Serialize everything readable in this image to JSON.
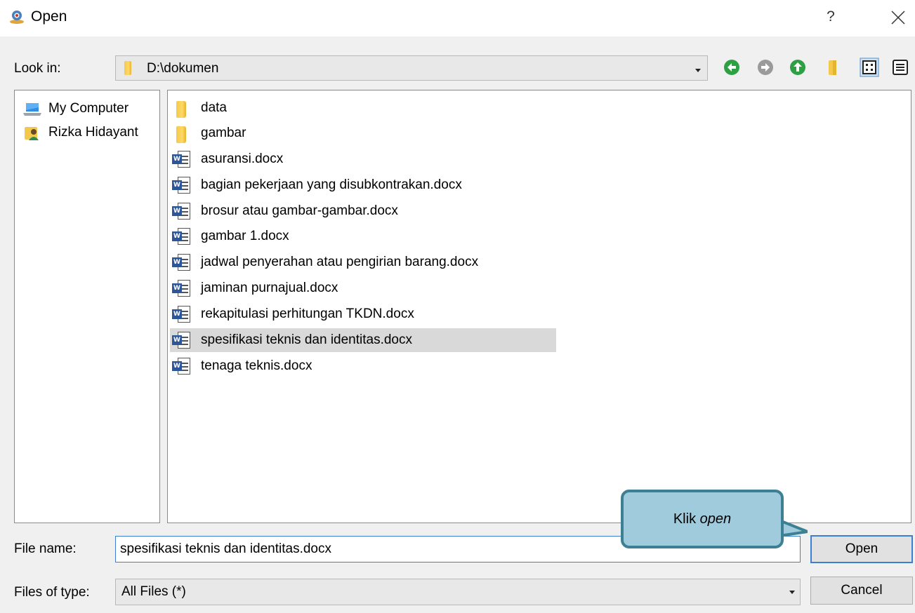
{
  "window": {
    "title": "Open",
    "help_label": "?",
    "close_icon": "close-icon",
    "app_icon": "java-app-icon"
  },
  "look_in": {
    "label": "Look in:",
    "value": "D:\\dokumen",
    "toolbar": [
      "back-icon",
      "forward-icon",
      "up-folder-icon",
      "new-folder-icon",
      "list-view-icon",
      "details-view-icon"
    ]
  },
  "sidebar": {
    "items": [
      {
        "label": "My Computer",
        "icon": "computer-icon"
      },
      {
        "label": "Rizka Hidayant",
        "icon": "user-folder-icon"
      }
    ]
  },
  "files": [
    {
      "name": "data",
      "type": "folder"
    },
    {
      "name": "gambar",
      "type": "folder"
    },
    {
      "name": "asuransi.docx",
      "type": "docx"
    },
    {
      "name": "bagian pekerjaan yang disubkontrakan.docx",
      "type": "docx"
    },
    {
      "name": "brosur atau gambar-gambar.docx",
      "type": "docx"
    },
    {
      "name": "gambar 1.docx",
      "type": "docx"
    },
    {
      "name": "jadwal penyerahan atau pengirian barang.docx",
      "type": "docx"
    },
    {
      "name": "jaminan purnajual.docx",
      "type": "docx"
    },
    {
      "name": "rekapitulasi perhitungan TKDN.docx",
      "type": "docx"
    },
    {
      "name": "spesifikasi teknis dan identitas.docx",
      "type": "docx",
      "selected": true
    },
    {
      "name": "tenaga teknis.docx",
      "type": "docx"
    }
  ],
  "file_name": {
    "label": "File name:",
    "value": "spesifikasi teknis dan identitas.docx"
  },
  "file_type": {
    "label": "Files of type:",
    "value": "All Files (*)"
  },
  "buttons": {
    "open": "Open",
    "cancel": "Cancel"
  },
  "callout": {
    "text_plain": "Klik ",
    "text_italic": "open"
  },
  "colors": {
    "accent": "#3c7fd1",
    "selection": "#d9d9d9",
    "callout_fill": "#9fcbdc",
    "callout_border": "#3d7f93",
    "nav_green": "#2ea043"
  }
}
